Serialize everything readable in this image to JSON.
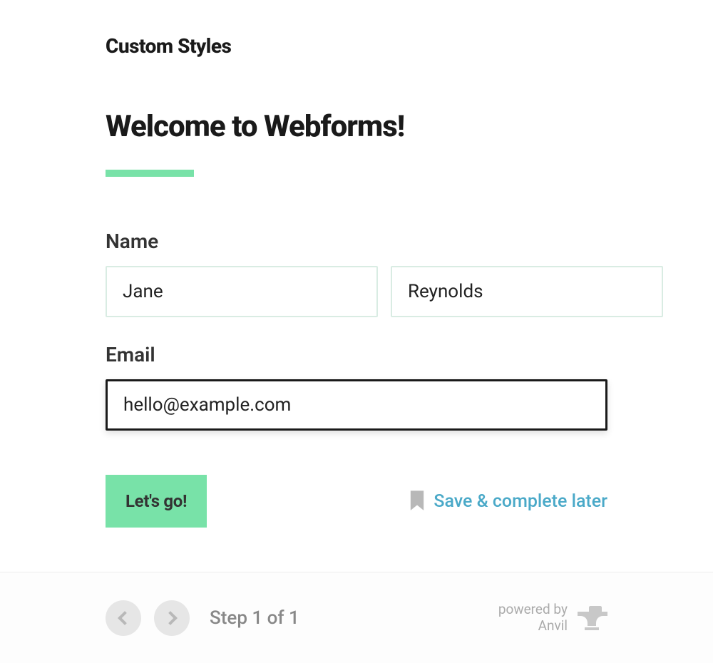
{
  "section_title": "Custom Styles",
  "page_title": "Welcome to Webforms!",
  "fields": {
    "name": {
      "label": "Name",
      "first_value": "Jane",
      "last_value": "Reynolds"
    },
    "email": {
      "label": "Email",
      "value": "hello@example.com"
    }
  },
  "actions": {
    "submit_label": "Let's go!",
    "save_later_label": "Save & complete later"
  },
  "footer": {
    "step_text": "Step 1 of 1",
    "powered_by_label": "powered by",
    "powered_by_brand": "Anvil"
  }
}
